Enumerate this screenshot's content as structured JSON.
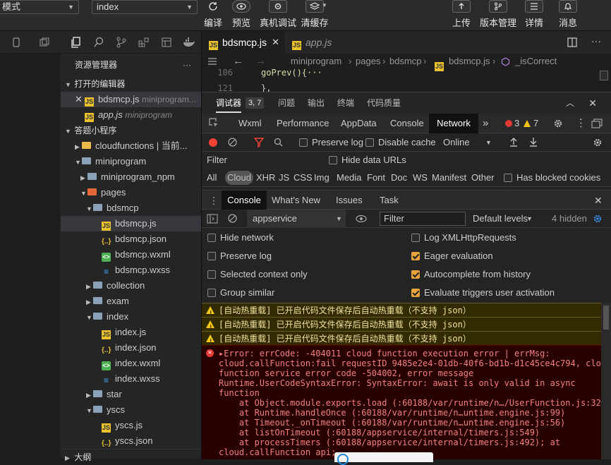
{
  "topbar": {
    "mode_select": "普通编译模式",
    "mode_select_visible": "模式",
    "page_select": "index",
    "buttons": [
      "编译",
      "预览",
      "真机调试",
      "清缓存"
    ],
    "right_buttons": [
      "上传",
      "版本管理",
      "详情",
      "消息"
    ]
  },
  "explorer": {
    "title": "资源管理器",
    "more": "···",
    "open_editors_label": "打开的编辑器",
    "open_editors": [
      {
        "name": "bdsmcp.js",
        "path": "miniprogram..."
      },
      {
        "name": "app.js",
        "path": "miniprogram"
      }
    ],
    "project_label": "答题小程序",
    "tree": [
      "cloudfunctions | 当前...",
      "miniprogram",
      "miniprogram_npm",
      "pages",
      "bdsmcp",
      "bdsmcp.js",
      "bdsmcp.json",
      "bdsmcp.wxml",
      "bdsmcp.wxss",
      "collection",
      "exam",
      "index",
      "index.js",
      "index.json",
      "index.wxml",
      "index.wxss",
      "star",
      "yscs",
      "yscs.js",
      "yscs.json"
    ],
    "outline_label": "大纲"
  },
  "editor": {
    "tabs": [
      {
        "name": "bdsmcp.js"
      },
      {
        "name": "app.js"
      }
    ],
    "breadcrumbs": [
      "miniprogram",
      "pages",
      "bdsmcp",
      "bdsmcp.js",
      "_isCorrect"
    ],
    "code_lines": [
      {
        "num": "106",
        "text": "goPrev(){···"
      },
      {
        "num": "121",
        "text": "},"
      }
    ]
  },
  "devtools": {
    "header_tabs": [
      "调试器",
      "问题",
      "输出",
      "终端",
      "代码质量"
    ],
    "header_badge": "3, 7",
    "panel_tabs": [
      "Wxml",
      "Performance",
      "AppData",
      "Console",
      "Network"
    ],
    "active_panel": "Network",
    "more_tabs": "»",
    "error_count": "3",
    "warning_count": "7",
    "network_toolbar": {
      "preserve_log": "Preserve log",
      "disable_cache": "Disable cache",
      "throttle": "Online"
    },
    "filter_placeholder": "Filter",
    "hide_data_urls": "Hide data URLs",
    "type_filters": [
      "All",
      "Cloud",
      "XHR",
      "JS",
      "CSS",
      "Img",
      "Media",
      "Font",
      "Doc",
      "WS",
      "Manifest",
      "Other"
    ],
    "has_blocked_cookies": "Has blocked cookies",
    "drawer_tabs": [
      "Console",
      "What's New",
      "Issues",
      "Task"
    ],
    "console_context": "appservice",
    "console_filter_placeholder": "Filter",
    "levels": "Default levels",
    "hidden": "4 hidden",
    "settings_left": [
      {
        "label": "Hide network",
        "checked": false
      },
      {
        "label": "Preserve log",
        "checked": false
      },
      {
        "label": "Selected context only",
        "checked": false
      },
      {
        "label": "Group similar",
        "checked": false
      }
    ],
    "settings_right": [
      {
        "label": "Log XMLHttpRequests",
        "checked": false
      },
      {
        "label": "Eager evaluation",
        "checked": true
      },
      {
        "label": "Autocomplete from history",
        "checked": true
      },
      {
        "label": "Evaluate triggers user activation",
        "checked": true
      }
    ],
    "warnings": [
      "[自动热重载] 已开启代码文件保存后自动热重载（不支持 json）",
      "[自动热重载] 已开启代码文件保存后自动热重载（不支持 json）",
      "[自动热重载] 已开启代码文件保存后自动热重载（不支持 json）"
    ],
    "error_lines": [
      "▸Error: errCode: -404011 cloud function execution error | errMsg:",
      "cloud.callFunction:fail requestID 9485e2e4-01db-40f6-bd1b-d1c45ce4c794, cloud",
      "function service error code -504002, error message",
      "Runtime.UserCodeSyntaxError: SyntaxError: await is only valid in async",
      "function",
      "    at Object.module.exports.load (:60188/var/runtime/n…/UserFunction.js:32)",
      "    at Runtime.handleOnce (:60188/var/runtime/n…untime.engine.js:99)",
      "    at Timeout._onTimeout (:60188/var/runtime/n…untime.engine.js:56)",
      "    at listOnTimeout (:60188/appservice/internal/timers.js:549)",
      "    at processTimers (:60188/appservice/internal/timers.js:492); at",
      "cloud.callFunction api;"
    ]
  },
  "colors": {
    "accent": "#1e88e5",
    "error_bg": "#290000",
    "warning_bg": "#332b00",
    "checkbox_on": "#e8a33d"
  }
}
